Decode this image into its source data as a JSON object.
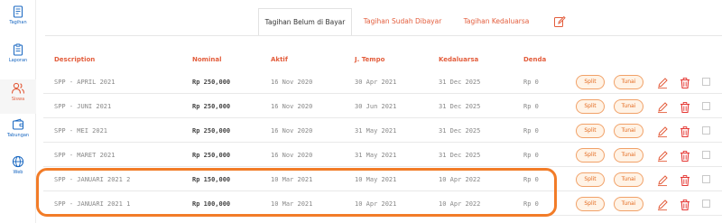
{
  "sidebar": {
    "items": [
      {
        "label": "Tagihan",
        "icon": "bill-icon"
      },
      {
        "label": "Laporan",
        "icon": "clipboard-icon"
      },
      {
        "label": "Siswa",
        "icon": "users-icon"
      },
      {
        "label": "Tabungan",
        "icon": "wallet-icon"
      },
      {
        "label": "Web",
        "icon": "globe-icon"
      }
    ]
  },
  "tabs": {
    "items": [
      {
        "label": "Tagihan Belum di Bayar"
      },
      {
        "label": "Tagihan Sudah Dibayar"
      },
      {
        "label": "Tagihan Kedaluarsa"
      }
    ],
    "edit_icon": "edit-icon"
  },
  "table": {
    "headers": {
      "description": "Description",
      "nominal": "Nominal",
      "aktif": "Aktif",
      "jtempo": "J. Tempo",
      "kedaluarsa": "Kedaluarsa",
      "denda": "Denda"
    },
    "split_label": "Split",
    "tunai_label": "Tunai",
    "rows": [
      {
        "description": "SPP - APRIL 2021",
        "nominal": "Rp 250,000",
        "aktif": "16 Nov 2020",
        "jtempo": "30 Apr 2021",
        "kedaluarsa": "31 Dec 2025",
        "denda": "Rp 0"
      },
      {
        "description": "SPP - JUNI 2021",
        "nominal": "Rp 250,000",
        "aktif": "16 Nov 2020",
        "jtempo": "30 Jun 2021",
        "kedaluarsa": "31 Dec 2025",
        "denda": "Rp 0"
      },
      {
        "description": "SPP - MEI 2021",
        "nominal": "Rp 250,000",
        "aktif": "16 Nov 2020",
        "jtempo": "31 May 2021",
        "kedaluarsa": "31 Dec 2025",
        "denda": "Rp 0"
      },
      {
        "description": "SPP - MARET 2021",
        "nominal": "Rp 250,000",
        "aktif": "16 Nov 2020",
        "jtempo": "31 May 2021",
        "kedaluarsa": "31 Dec 2025",
        "denda": "Rp 0"
      },
      {
        "description": "SPP - JANUARI 2021 2",
        "nominal": "Rp 150,000",
        "aktif": "10 Mar 2021",
        "jtempo": "10 May 2021",
        "kedaluarsa": "10 Apr 2022",
        "denda": "Rp 0"
      },
      {
        "description": "SPP - JANUARI 2021 1",
        "nominal": "Rp 100,000",
        "aktif": "10 Mar 2021",
        "jtempo": "10 Apr 2021",
        "kedaluarsa": "10 Apr 2022",
        "denda": "Rp 0"
      }
    ]
  },
  "colors": {
    "accent": "#e35d3c",
    "sidebar_icon": "#1565c0",
    "highlight": "#f27c28",
    "pill_bg": "#fff3e6",
    "delete": "#e53935"
  }
}
